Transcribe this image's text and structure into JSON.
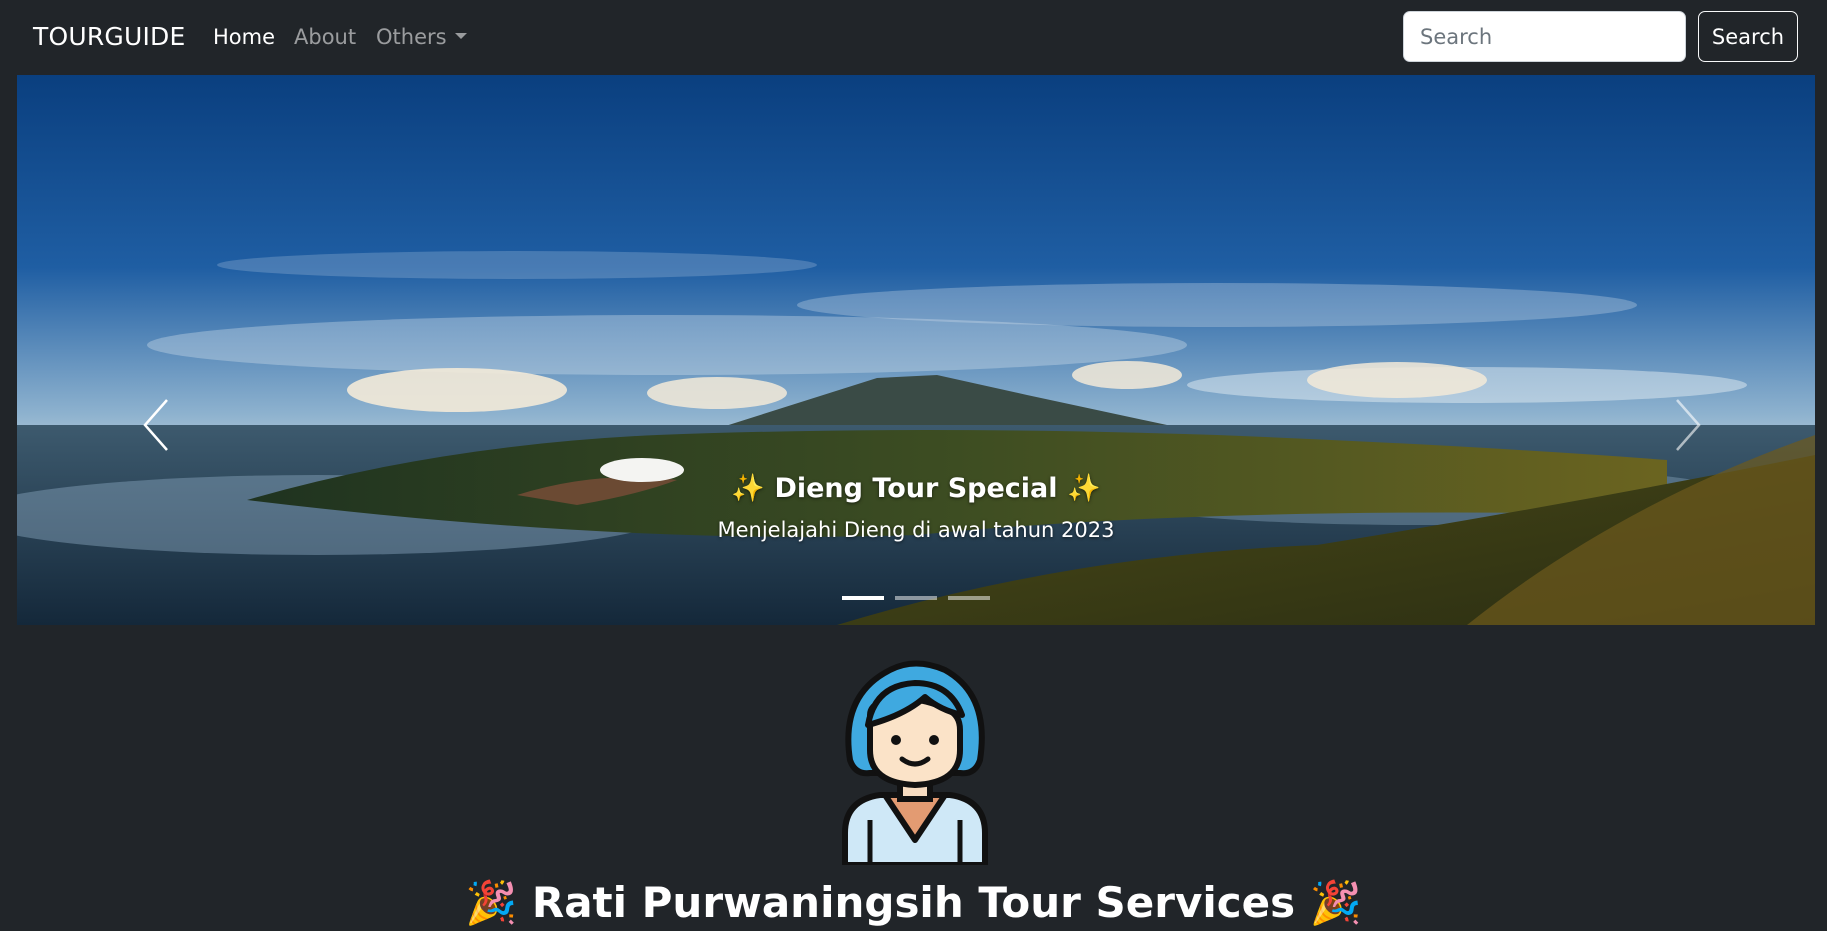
{
  "navbar": {
    "brand": "TOURGUIDE",
    "links": [
      {
        "label": "Home",
        "active": true
      },
      {
        "label": "About",
        "active": false
      },
      {
        "label": "Others",
        "active": false,
        "dropdown": true
      }
    ],
    "search": {
      "placeholder": "Search",
      "button_label": "Search"
    }
  },
  "carousel": {
    "caption_title": "Dieng Tour Special",
    "caption_subtitle": "Menjelajahi Dieng di awal tahun 2023",
    "title_emoji": "✨",
    "slide_count": 3,
    "active_slide": 1
  },
  "profile": {
    "headline": "Rati Purwaningsih Tour Services",
    "headline_emoji": "🎉"
  },
  "colors": {
    "background": "#212529",
    "sky_top": "#0a3f7f",
    "sky_bottom": "#7ea8c9",
    "avatar_hair": "#3fa9e0"
  }
}
